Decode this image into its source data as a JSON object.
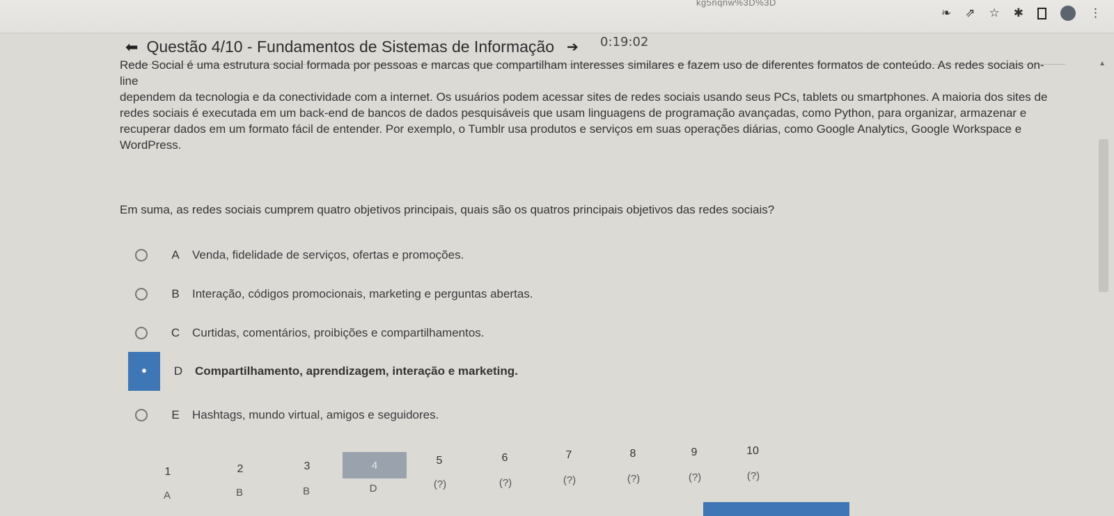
{
  "browser": {
    "url_tail": "kg5nqnw%3D%3D",
    "icons": [
      "key-icon",
      "share-icon",
      "star-icon",
      "extension-icon",
      "sidebar-icon",
      "avatar",
      "menu-icon"
    ]
  },
  "timer": "0:19:02",
  "header": {
    "title": "Questão 4/10 - Fundamentos de Sistemas de Informação"
  },
  "passage": {
    "lines": [
      "Rede Social é uma estrutura social formada por pessoas e marcas que compartilham interesses similares e fazem uso de diferentes formatos de conteúdo. As redes sociais on-line",
      "dependem da tecnologia e da conectividade com a internet. Os usuários podem acessar sites de redes sociais usando seus PCs, tablets ou smartphones. A maioria dos sites de",
      "redes sociais é executada em um back-end de bancos de dados pesquisáveis que usam linguagens de programação avançadas, como Python, para organizar, armazenar e",
      "recuperar dados em um formato fácil de entender. Por exemplo, o Tumblr usa produtos e serviços em suas operações diárias, como Google Analytics, Google Workspace e",
      "WordPress."
    ]
  },
  "question": "Em suma, as redes sociais cumprem quatro objetivos principais, quais são os quatros principais objetivos das redes sociais?",
  "options": [
    {
      "letter": "A",
      "text": "Venda, fidelidade de serviços, ofertas e promoções."
    },
    {
      "letter": "B",
      "text": "Interação, códigos promocionais, marketing e perguntas abertas."
    },
    {
      "letter": "C",
      "text": "Curtidas, comentários, proibições e compartilhamentos."
    },
    {
      "letter": "D",
      "text": "Compartilhamento, aprendizagem, interação e marketing.",
      "selected": true
    },
    {
      "letter": "E",
      "text": "Hashtags, mundo virtual, amigos e seguidores."
    }
  ],
  "navigation": {
    "numbers": [
      "1",
      "2",
      "3",
      "4",
      "5",
      "6",
      "7",
      "8",
      "9",
      "10"
    ],
    "answers": [
      "A",
      "B",
      "B",
      "D",
      "(?)",
      "(?)",
      "(?)",
      "(?)",
      "(?)",
      "(?)"
    ],
    "current": "4"
  },
  "colors": {
    "accent": "#3f76b5",
    "background": "#dcdad5"
  }
}
